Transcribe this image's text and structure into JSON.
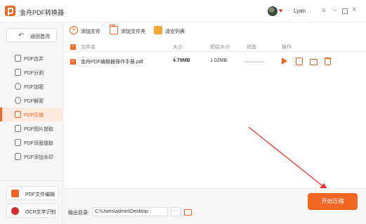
{
  "window": {
    "title": "金舟PDF转换器",
    "user_name": "Lyan",
    "menu_glyph": "≡",
    "minimize_glyph": "–",
    "close_glyph": "×",
    "vip_glyph": "♥"
  },
  "sidebar": {
    "back_label": "返回首页",
    "back_glyph": "↶",
    "items": [
      {
        "label": "PDF合并",
        "icon": "merge-icon"
      },
      {
        "label": "PDF分割",
        "icon": "split-icon"
      },
      {
        "label": "PDF加密",
        "icon": "lock-icon"
      },
      {
        "label": "PDF解密",
        "icon": "unlock-icon"
      },
      {
        "label": "PDF压缩",
        "icon": "compress-icon",
        "active": true
      },
      {
        "label": "PDF图片提取",
        "icon": "image-icon"
      },
      {
        "label": "PDF页面提取",
        "icon": "page-icon"
      },
      {
        "label": "PDF添加水印",
        "icon": "watermark-icon"
      }
    ],
    "extras": [
      {
        "label": "PDF文件编辑",
        "icon": "pdf-editor-icon",
        "color": "#f26522"
      },
      {
        "label": "OCR文字识别",
        "icon": "ocr-icon",
        "color": "#d92b2b"
      }
    ]
  },
  "toolbar": {
    "add_file": "添加文件",
    "add_folder": "添加文件夹",
    "clear_list": "清空列表",
    "add_glyph": "+"
  },
  "table": {
    "headers": [
      "文件名",
      "大小",
      "预估大小",
      "状态",
      "操作"
    ],
    "rows": [
      {
        "name": "金舟PDF编辑器操作手册.pdf",
        "size": "4.79MB",
        "estimate": "1.02MB",
        "progress": 0.0
      }
    ],
    "check_glyph": "✓"
  },
  "footer": {
    "output_label": "输出目录:",
    "output_path": "C:\\Users\\admin\\Desktop",
    "more_glyph": "···",
    "start_label": "开始压缩"
  },
  "colors": {
    "accent": "#f26522",
    "sidebar_bg": "#f5f6f8",
    "active_bg": "#fde9de",
    "annotation": "#e8362b"
  }
}
